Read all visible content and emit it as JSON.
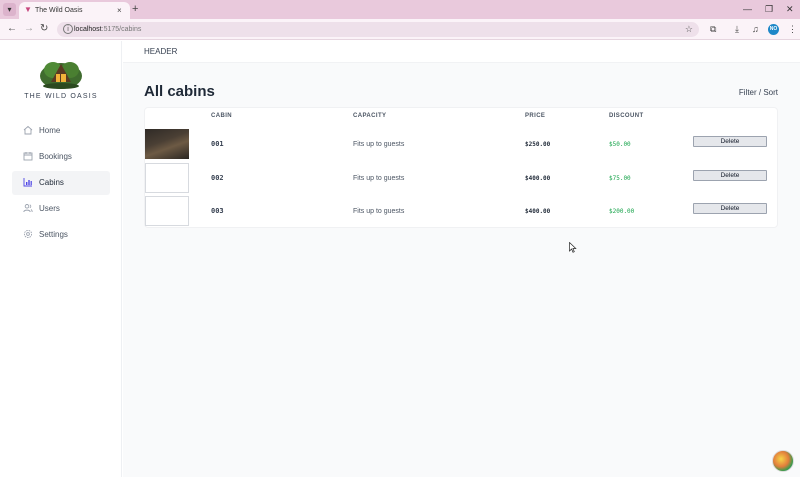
{
  "browser": {
    "tab_title": "The Wild Oasis",
    "url_host": "localhost",
    "url_path": ":5175/cabins",
    "new_tab": "+",
    "tab_close": "×",
    "profile_initials": "NO"
  },
  "sidebar": {
    "logo_text": "THE WILD OASIS",
    "items": [
      {
        "label": "Home",
        "icon": "home-icon"
      },
      {
        "label": "Bookings",
        "icon": "calendar-icon"
      },
      {
        "label": "Cabins",
        "icon": "chart-icon",
        "active": true
      },
      {
        "label": "Users",
        "icon": "users-icon"
      },
      {
        "label": "Settings",
        "icon": "gear-icon"
      }
    ]
  },
  "header": {
    "text": "HEADER"
  },
  "page": {
    "title": "All cabins",
    "filter_sort": "Filter / Sort"
  },
  "table": {
    "headers": {
      "cabin": "CABIN",
      "capacity": "CAPACITY",
      "price": "PRICE",
      "discount": "DISCOUNT"
    },
    "rows": [
      {
        "name": "001",
        "capacity": "Fits up to guests",
        "price": "$250.00",
        "discount": "$50.00",
        "delete": "Delete"
      },
      {
        "name": "002",
        "capacity": "Fits up to guests",
        "price": "$400.00",
        "discount": "$75.00",
        "delete": "Delete"
      },
      {
        "name": "003",
        "capacity": "Fits up to guests",
        "price": "$400.00",
        "discount": "$200.00",
        "delete": "Delete"
      }
    ]
  },
  "colors": {
    "accent": "#4f46e5",
    "discount": "#16a34a",
    "tabbar": "#e9c9dc"
  }
}
